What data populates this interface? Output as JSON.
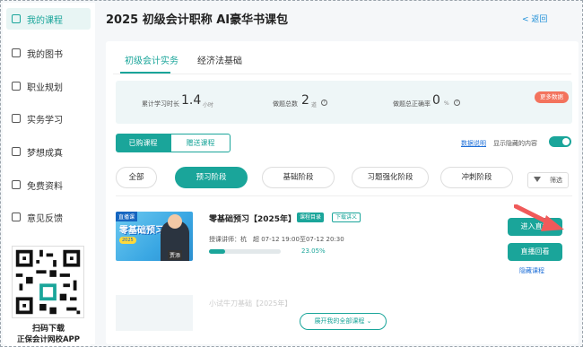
{
  "sidebar": {
    "items": [
      {
        "label": "我的课程",
        "icon": "course-icon",
        "active": true
      },
      {
        "label": "我的图书",
        "icon": "book-icon",
        "active": false
      },
      {
        "label": "职业规划",
        "icon": "plan-icon",
        "active": false
      },
      {
        "label": "实务学习",
        "icon": "monitor-icon",
        "active": false
      },
      {
        "label": "梦想成真",
        "icon": "rocket-icon",
        "active": false
      },
      {
        "label": "免费资料",
        "icon": "folder-icon",
        "active": false
      },
      {
        "label": "意见反馈",
        "icon": "mail-icon",
        "active": false
      }
    ],
    "qr_line1": "扫码下载",
    "qr_line2": "正保会计网校APP"
  },
  "header": {
    "title": "2025 初级会计职称 AI豪华书课包",
    "back": "< 返回"
  },
  "tabs": [
    {
      "label": "初级会计实务",
      "active": true
    },
    {
      "label": "经济法基础",
      "active": false
    }
  ],
  "stats": {
    "study_time_label": "累计学习时长",
    "study_time_value": "1.4",
    "study_time_unit": "小时",
    "questions_label": "做题总数",
    "questions_value": "2",
    "questions_unit": "道",
    "accuracy_label": "做题总正确率",
    "accuracy_value": "0",
    "accuracy_unit": "%",
    "more_label": "更多数据"
  },
  "purchase_tabs": {
    "bought": "已购课程",
    "gifted": "赠送课程"
  },
  "data_explain": "数据说明",
  "show_hidden": "显示隐藏的内容",
  "stages": [
    {
      "label": "全部",
      "active": false
    },
    {
      "label": "预习阶段",
      "active": true
    },
    {
      "label": "基础阶段",
      "active": false
    },
    {
      "label": "习题强化阶段",
      "active": false
    },
    {
      "label": "冲刺阶段",
      "active": false
    }
  ],
  "filter": "筛选",
  "course": {
    "thumb_tag": "直播课",
    "thumb_title": "零基础预习",
    "thumb_name": "贾添",
    "title": "零基础预习【2025年】",
    "badge_catalog": "课程目录",
    "badge_download": "下载讲义",
    "teacher": "授课讲师：杭　超 07-12 19:00至07-12 20:30",
    "progress_pct": 23.05,
    "progress_text": "23.05%",
    "btn_live": "进入直播",
    "btn_replay": "直播回看",
    "hide": "隐藏课程"
  },
  "faded_course": "小试牛刀基础【2025年】",
  "expand_label": "展开我的全部课程",
  "colors": {
    "accent": "#1aa59a",
    "arrow": "#f05a5a",
    "more_data": "#f3735d"
  }
}
